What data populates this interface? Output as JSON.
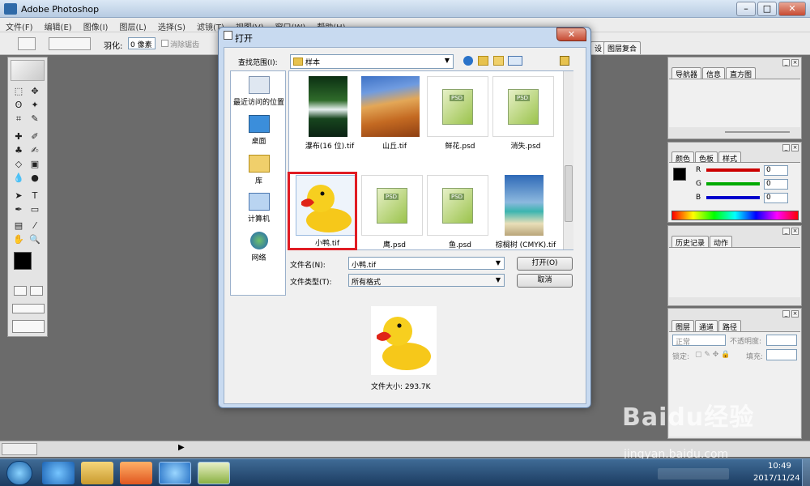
{
  "app": {
    "title": "Adobe Photoshop"
  },
  "menu": [
    "文件(F)",
    "编辑(E)",
    "图像(I)",
    "图层(L)",
    "选择(S)",
    "滤镜(T)",
    "视图(V)",
    "窗口(W)",
    "帮助(H)"
  ],
  "options": {
    "feather_label": "羽化:",
    "feather_value": "0 像素",
    "antialias_label": "消除锯齿"
  },
  "palettes": {
    "nav": {
      "tabs": [
        "导航器",
        "信息",
        "直方图"
      ]
    },
    "color": {
      "tabs": [
        "颜色",
        "色板",
        "样式"
      ],
      "r_label": "R",
      "g_label": "G",
      "b_label": "B",
      "r": "0",
      "g": "0",
      "b": "0"
    },
    "history": {
      "tabs": [
        "历史记录",
        "动作"
      ]
    },
    "layers": {
      "tabs": [
        "图层",
        "通道",
        "路径"
      ],
      "blend_mode": "正常",
      "opacity_label": "不透明度:",
      "lock_label": "锁定:",
      "fill_label": "填充:"
    },
    "top_tabs": [
      "设",
      "图层复合"
    ]
  },
  "dialog": {
    "title": "打开",
    "lookin_label": "查找范围(I):",
    "lookin_value": "样本",
    "places": [
      "最近访问的位置",
      "桌面",
      "库",
      "计算机",
      "网络"
    ],
    "files": [
      {
        "name": "瀑布(16 位).tif",
        "kind": "photo-waterfall"
      },
      {
        "name": "山丘.tif",
        "kind": "photo-dune"
      },
      {
        "name": "鲜花.psd",
        "kind": "psd"
      },
      {
        "name": "消失.psd",
        "kind": "psd"
      },
      {
        "name": "小鸭.tif",
        "kind": "duck"
      },
      {
        "name": "鹰.psd",
        "kind": "psd"
      },
      {
        "name": "鱼.psd",
        "kind": "psd"
      },
      {
        "name": "棕榈树 (CMYK).tif",
        "kind": "photo-palm"
      }
    ],
    "filename_label": "文件名(N):",
    "filename_value": "小鸭.tif",
    "filetype_label": "文件类型(T):",
    "filetype_value": "所有格式",
    "open_button": "打开(O)",
    "cancel_button": "取消",
    "filesize": "文件大小: 293.7K",
    "psd_badge": "PSD"
  },
  "watermark": {
    "text": "Baidu经验",
    "url": "jingyan.baidu.com"
  },
  "clock": {
    "time": "10:49",
    "date": "2017/11/24"
  },
  "colors": {
    "selection": "#e01c23",
    "titlebar": "#c8daf0"
  }
}
